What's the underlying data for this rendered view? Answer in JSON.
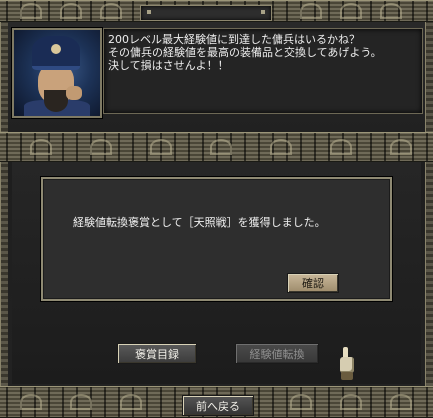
{
  "npc_dialogue": {
    "text": "200レベル最大経験値に到達した傭兵はいるかね？\nその傭兵の経験値を最高の装備品と交換してあげよう。\n決して損はさせんよ！！"
  },
  "modal": {
    "message": "経験値転換褒賞として［天照戦］を獲得しました。",
    "confirm_label": "確認"
  },
  "buttons": {
    "reward_list_label": "褒賞目録",
    "exp_exchange_label": "経験値転換",
    "back_label": "前へ戻る"
  },
  "icons": {
    "portrait": "npc-portrait",
    "cursor": "gauntlet-cursor-icon"
  },
  "colors": {
    "confirm_button": "#b5a383",
    "dialogue_text": "#eeeeee"
  }
}
